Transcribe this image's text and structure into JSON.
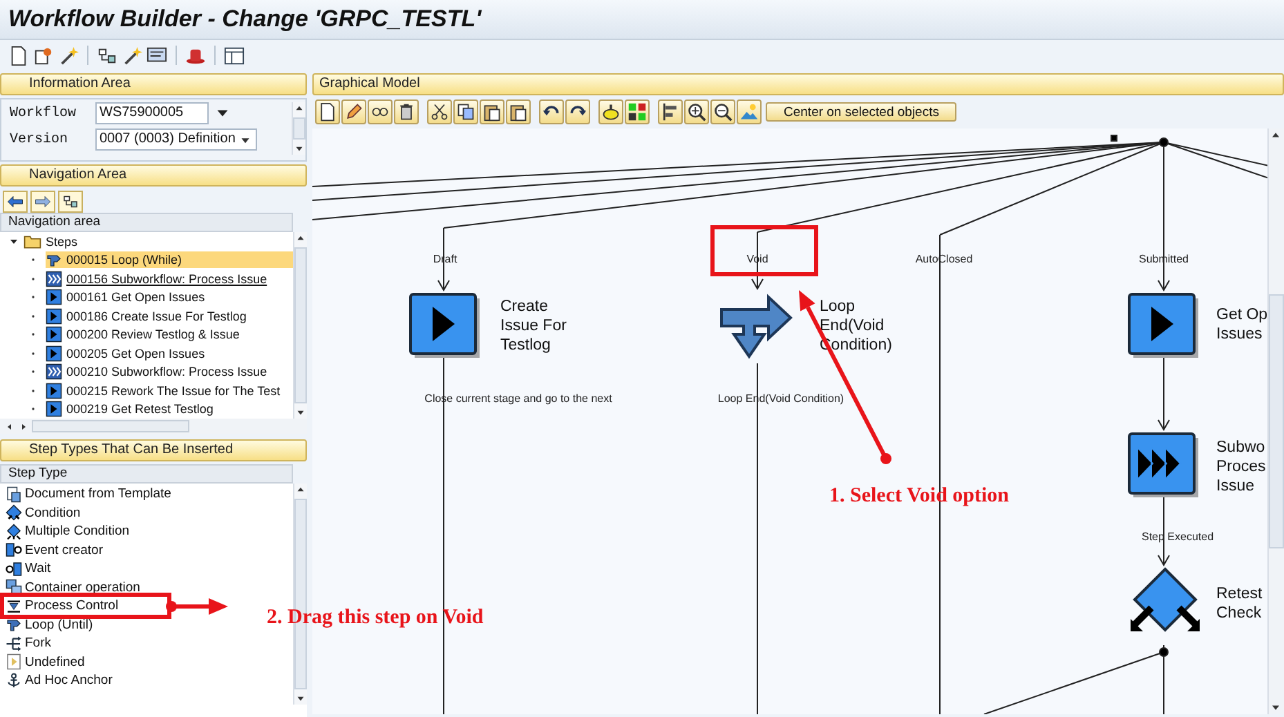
{
  "window": {
    "title": "Workflow Builder - Change 'GRPC_TESTL'"
  },
  "information_area": {
    "title": "Information Area",
    "fields": [
      {
        "kind": "input",
        "label": "Workflow",
        "value": "WS75900005"
      },
      {
        "kind": "dropdown",
        "label": "Version",
        "value": "0007 (0003) Definition"
      }
    ]
  },
  "navigation_area": {
    "title": "Navigation Area",
    "column": "Navigation area",
    "tree": [
      {
        "label": "Steps",
        "expanded": true,
        "children": [
          {
            "kind": "loop",
            "label": "000015 Loop (While)",
            "selected": true,
            "hovered": false
          },
          {
            "kind": "subworkflow",
            "label": "000156 Subworkflow: Process Issue",
            "selected": false,
            "hovered": true
          },
          {
            "kind": "activity",
            "label": "000161 Get Open Issues",
            "selected": false,
            "hovered": false
          },
          {
            "kind": "activity",
            "label": "000186 Create Issue For Testlog",
            "selected": false,
            "hovered": false
          },
          {
            "kind": "activity",
            "label": "000200 Review Testlog & Issue",
            "selected": false,
            "hovered": false
          },
          {
            "kind": "activity",
            "label": "000205 Get Open Issues",
            "selected": false,
            "hovered": false
          },
          {
            "kind": "subworkflow",
            "label": "000210 Subworkflow: Process Issue",
            "selected": false,
            "hovered": false
          },
          {
            "kind": "activity",
            "label": "000215 Rework The Issue for The Test",
            "selected": false,
            "hovered": false
          },
          {
            "kind": "activity",
            "label": "000219 Get Retest Testlog",
            "selected": false,
            "hovered": false
          }
        ]
      }
    ]
  },
  "step_types": {
    "title": "Step Types That Can Be Inserted",
    "column": "Step Type",
    "items": [
      {
        "kind": "document",
        "label": "Document from Template"
      },
      {
        "kind": "condition",
        "label": "Condition"
      },
      {
        "kind": "multiple-condition",
        "label": "Multiple Condition"
      },
      {
        "kind": "event",
        "label": "Event creator"
      },
      {
        "kind": "wait",
        "label": "Wait"
      },
      {
        "kind": "container",
        "label": "Container operation"
      },
      {
        "kind": "process-control",
        "label": "Process Control"
      },
      {
        "kind": "loop",
        "label": "Loop (Until)"
      },
      {
        "kind": "fork",
        "label": "Fork"
      },
      {
        "kind": "undefined",
        "label": "Undefined"
      },
      {
        "kind": "anchor",
        "label": "Ad Hoc Anchor"
      }
    ]
  },
  "graphical_model": {
    "title": "Graphical Model",
    "toolbar_button": "Center on selected objects",
    "edge_labels": [
      "Draft",
      "Void",
      "AutoClosed",
      "Submitted",
      "Close current stage and go to the next",
      "Loop End(Void Condition)",
      "Step Executed"
    ],
    "nodes": [
      {
        "kind": "activity",
        "label": "Create\nIssue For\nTestlog"
      },
      {
        "kind": "loop-end",
        "label": "Loop\nEnd(Void\nCondition)"
      },
      {
        "kind": "activity",
        "label": "Get Op\nIssues"
      },
      {
        "kind": "subworkflow",
        "label": "Subwo\nProces\nIssue"
      },
      {
        "kind": "condition",
        "label": "Retest\nCheck"
      }
    ]
  },
  "annotations": [
    {
      "text": "1. Select Void option"
    },
    {
      "text": "2. Drag this step on Void"
    }
  ]
}
